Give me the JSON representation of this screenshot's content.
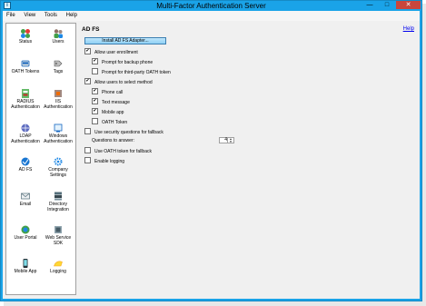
{
  "window": {
    "title": "Multi-Factor Authentication Server",
    "min": "—",
    "max": "□",
    "close": "✕"
  },
  "menu": [
    "File",
    "View",
    "Tools",
    "Help"
  ],
  "sidebar": {
    "items": [
      {
        "label": "Status",
        "icon": "status-icon",
        "color": "#2e7d32"
      },
      {
        "label": "Users",
        "icon": "users-icon",
        "color": "#5d4037"
      },
      {
        "label": "OATH Tokens",
        "icon": "oath-tokens-icon",
        "color": "#1565c0"
      },
      {
        "label": "Tags",
        "icon": "tags-icon",
        "color": "#555555"
      },
      {
        "label": "RADIUS Authentication",
        "icon": "radius-icon",
        "color": "#2e7d32"
      },
      {
        "label": "IIS Authentication",
        "icon": "iis-icon",
        "color": "#6d4c41"
      },
      {
        "label": "LDAP Authentication",
        "icon": "ldap-icon",
        "color": "#3949ab"
      },
      {
        "label": "Windows Authentication",
        "icon": "windows-icon",
        "color": "#1565c0"
      },
      {
        "label": "AD FS",
        "icon": "adfs-icon",
        "color": "#1976d2"
      },
      {
        "label": "Company Settings",
        "icon": "company-settings-icon",
        "color": "#1e88e5"
      },
      {
        "label": "Email",
        "icon": "email-icon",
        "color": "#546e7a"
      },
      {
        "label": "Directory Integration",
        "icon": "directory-icon",
        "color": "#37474f"
      },
      {
        "label": "User Portal",
        "icon": "user-portal-icon",
        "color": "#2e7d32"
      },
      {
        "label": "Web Service SDK",
        "icon": "sdk-icon",
        "color": "#455a64"
      },
      {
        "label": "Mobile App",
        "icon": "mobile-app-icon",
        "color": "#263238"
      },
      {
        "label": "Logging",
        "icon": "logging-icon",
        "color": "#f9a825"
      }
    ]
  },
  "main": {
    "heading": "AD FS",
    "help": "Help",
    "install_button": "Install AD FS Adapter...",
    "options": [
      {
        "label": "Allow user enrollment",
        "checked": true
      },
      {
        "label": "Prompt for backup phone",
        "checked": true
      },
      {
        "label": "Prompt for third-party OATH token",
        "checked": false
      },
      {
        "label": "Allow users to select method",
        "checked": true
      },
      {
        "label": "Phone call",
        "checked": true
      },
      {
        "label": "Text message",
        "checked": true
      },
      {
        "label": "Mobile app",
        "checked": true
      },
      {
        "label": "OATH Token",
        "checked": false
      },
      {
        "label": "Use security questions for fallback",
        "checked": false
      },
      {
        "label": "Use OATH token for fallback",
        "checked": false
      },
      {
        "label": "Enable logging",
        "checked": false
      }
    ],
    "questions_label": "Questions to answer:",
    "questions_value": "4"
  }
}
